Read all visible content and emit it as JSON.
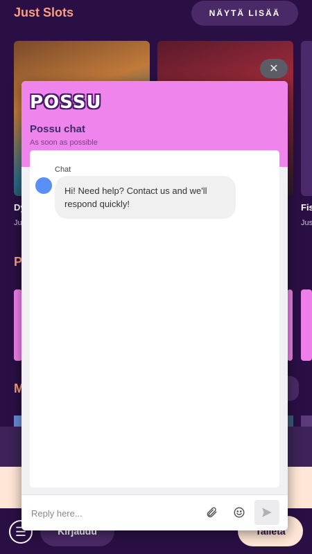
{
  "background": {
    "section_title": "Just Slots",
    "more_button": "NÄYTÄ LISÄÄ",
    "games": [
      {
        "name": "Dy",
        "provider": "Ju"
      },
      {
        "name": "Fis",
        "provider": "Jus"
      }
    ],
    "section2_title": "P",
    "section3_title": "M",
    "login_button": "Kirjaudu",
    "deposit_button": "Talleta",
    "menu_icon": "hamburger-icon"
  },
  "chat": {
    "close_icon": "close-icon",
    "logo_text": "POSSU",
    "title": "Possu chat",
    "subtitle": "As soon as possible",
    "agent_name": "Chat",
    "message": "Hi! Need help? Contact us and we'll respond quickly!",
    "reply_placeholder": "Reply here...",
    "attach_icon": "paperclip-icon",
    "emoji_icon": "smiley-icon",
    "send_icon": "send-icon"
  },
  "colors": {
    "page_bg": "#2a0f45",
    "accent_orange": "#ff9e7a",
    "chat_header_pink": "#ef84ec",
    "chat_title": "#3f2b66",
    "avatar_blue": "#5b8ff5"
  }
}
